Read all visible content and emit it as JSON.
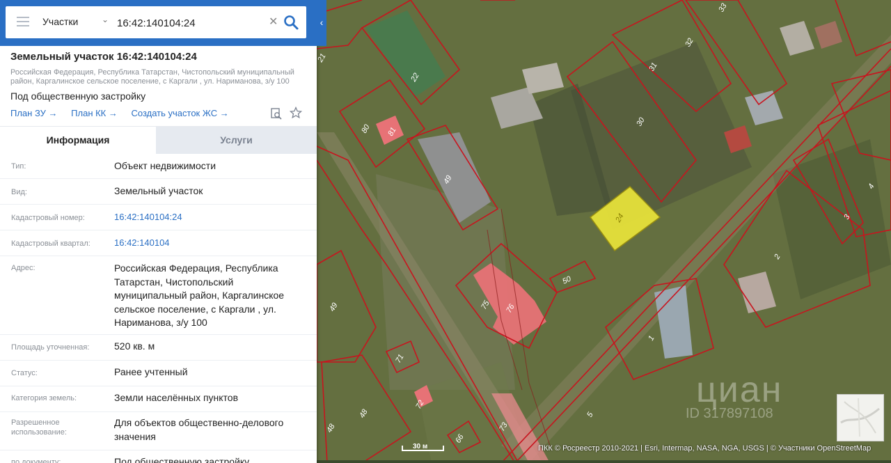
{
  "search": {
    "type_label": "Участки",
    "query": "16:42:140104:24"
  },
  "parcel": {
    "title": "Земельный участок 16:42:140104:24",
    "address_line": "Российская Федерация, Республика Татарстан, Чистопольский муниципальный район, Каргалинское сельское поселение, с Каргали , ул. Нариманова, з/у 100",
    "purpose": "Под общественную застройку",
    "links": [
      "План ЗУ →",
      "План КК →",
      "Создать участок ЖС →"
    ]
  },
  "tabs": [
    "Информация",
    "Услуги"
  ],
  "info": [
    {
      "label": "Тип:",
      "value": "Объект недвижимости"
    },
    {
      "label": "Вид:",
      "value": "Земельный участок"
    },
    {
      "label": "Кадастровый номер:",
      "value": "16:42:140104:24"
    },
    {
      "label": "Кадастровый квартал:",
      "value": "16:42:140104"
    },
    {
      "label": "Адрес:",
      "value": "Российская Федерация, Республика Татарстан, Чистопольский муниципальный район, Каргалинское сельское поселение, с Каргали , ул. Нариманова, з/у 100"
    },
    {
      "label": "Площадь уточненная:",
      "value": "520 кв. м"
    },
    {
      "label": "Статус:",
      "value": "Ранее учтенный"
    },
    {
      "label": "Категория земель:",
      "value": "Земли населённых пунктов"
    },
    {
      "label": "Разрешенное использование:",
      "value": "Для объектов общественно-делового значения"
    },
    {
      "label": "по документу:",
      "value": "Под общественную застройку"
    }
  ],
  "map": {
    "scale": "30 м",
    "attribution": "ПКК © Росреестр 2010-2021 | Esri, Intermap, NASA, NGA, USGS | © Участники OpenStreetMap",
    "watermark": "циан",
    "watermark_id": "ID 317897108",
    "parcel_labels": [
      "21",
      "22",
      "33",
      "32",
      "31",
      "30",
      "80",
      "81",
      "49",
      "24",
      "4",
      "3",
      "2",
      "50",
      "75",
      "76",
      "1",
      "49",
      "71",
      "72",
      "48",
      "48",
      "66",
      "73",
      "5"
    ],
    "selected_color": "#e6e13a",
    "boundary_color": "#c8141e"
  }
}
